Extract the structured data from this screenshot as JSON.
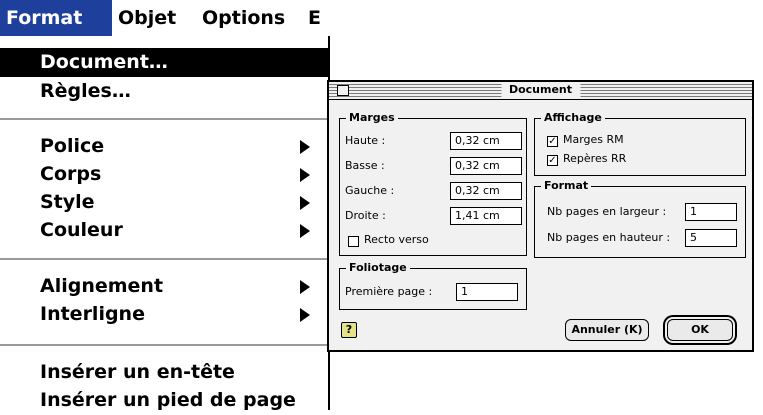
{
  "menubar": {
    "items": [
      {
        "label": "Format"
      },
      {
        "label": "Objet"
      },
      {
        "label": "Options"
      },
      {
        "label": "E"
      }
    ]
  },
  "format_menu": {
    "items": [
      {
        "label": "Document…"
      },
      {
        "label": "Règles…"
      },
      {
        "label": "Police"
      },
      {
        "label": "Corps"
      },
      {
        "label": "Style"
      },
      {
        "label": "Couleur"
      },
      {
        "label": "Alignement"
      },
      {
        "label": "Interligne"
      },
      {
        "label": "Insérer un en-tête"
      },
      {
        "label": "Insérer un pied de page"
      }
    ]
  },
  "dialog": {
    "title": "Document",
    "marges": {
      "legend": "Marges",
      "haute_label": "Haute :",
      "haute_value": "0,32 cm",
      "basse_label": "Basse :",
      "basse_value": "0,32 cm",
      "gauche_label": "Gauche :",
      "gauche_value": "0,32 cm",
      "droite_label": "Droite :",
      "droite_value": "1,41 cm",
      "recto_verso_label": "Recto verso"
    },
    "affichage": {
      "legend": "Affichage",
      "marges_rm_label": "Marges RM",
      "reperes_rr_label": "Repères RR"
    },
    "format": {
      "legend": "Format",
      "largeur_label": "Nb pages en largeur :",
      "largeur_value": "1",
      "hauteur_label": "Nb pages en hauteur :",
      "hauteur_value": "5"
    },
    "foliotage": {
      "legend": "Foliotage",
      "premiere_label": "Première page :",
      "premiere_value": "1"
    },
    "help_glyph": "?",
    "cancel_label": "Annuler (K)",
    "ok_label": "OK"
  }
}
